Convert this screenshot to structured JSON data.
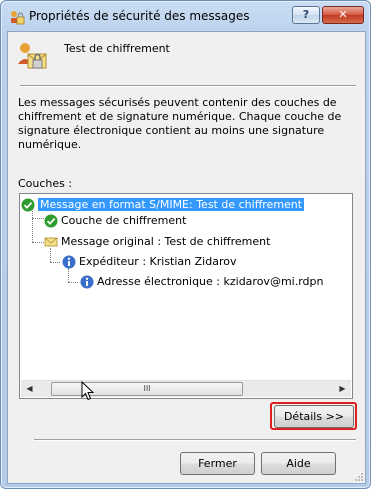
{
  "window": {
    "title": "Propriétés de sécurité des messages",
    "help_label": "?",
    "close_label": "✕"
  },
  "header": {
    "title": "Test de chiffrement"
  },
  "description": "Les messages sécurisés peuvent contenir des couches de chiffrement et de signature numérique. Chaque couche de signature électronique contient au moins une signature numérique.",
  "layers_label": "Couches :",
  "tree": {
    "items": [
      {
        "label": "Message en format S/MIME: Test de chiffrement",
        "icon": "green-check-icon",
        "selected": true
      },
      {
        "label": "Couche de chiffrement",
        "icon": "green-check-icon",
        "selected": false
      },
      {
        "label": "Message original : Test de chiffrement",
        "icon": "envelope-icon",
        "selected": false
      },
      {
        "label": "Expéditeur : Kristian Zidarov",
        "icon": "info-icon",
        "selected": false
      },
      {
        "label": "Adresse électronique : kzidarov@mi.rdpn",
        "icon": "info-icon",
        "selected": false
      }
    ]
  },
  "scrollbar": {
    "thumb_grip": "III"
  },
  "buttons": {
    "details": "Détails >>",
    "close": "Fermer",
    "help": "Aide"
  },
  "colors": {
    "selection": "#3399ff",
    "highlight": "#e02020",
    "titlebar": "#b9d0ec"
  }
}
